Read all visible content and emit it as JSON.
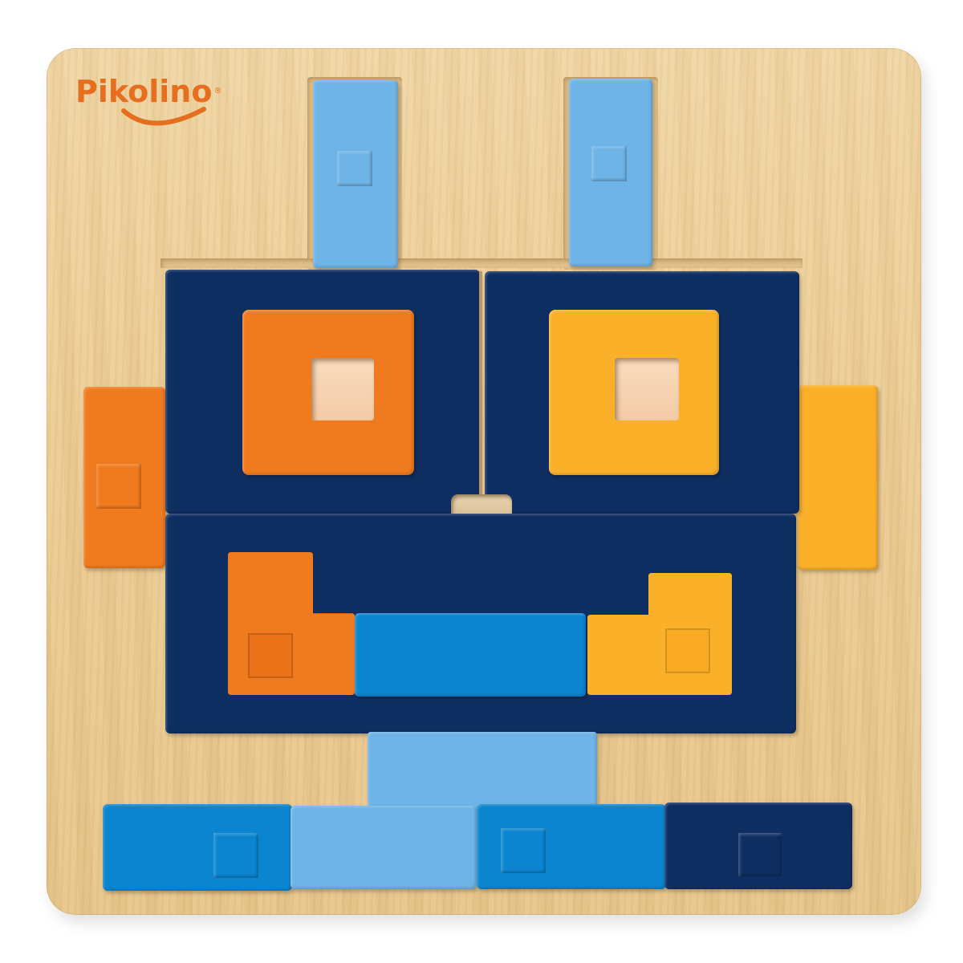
{
  "brand": {
    "name": "Pikolino",
    "registered_mark": "®",
    "color": "#e56f1f"
  },
  "palette": {
    "wood": "#ebcb93",
    "light_blue": "#6fb4e6",
    "medium_blue": "#0b85d0",
    "dark_blue": "#0f2f63",
    "orange": "#f07a1e",
    "yellow": "#fbb029"
  }
}
